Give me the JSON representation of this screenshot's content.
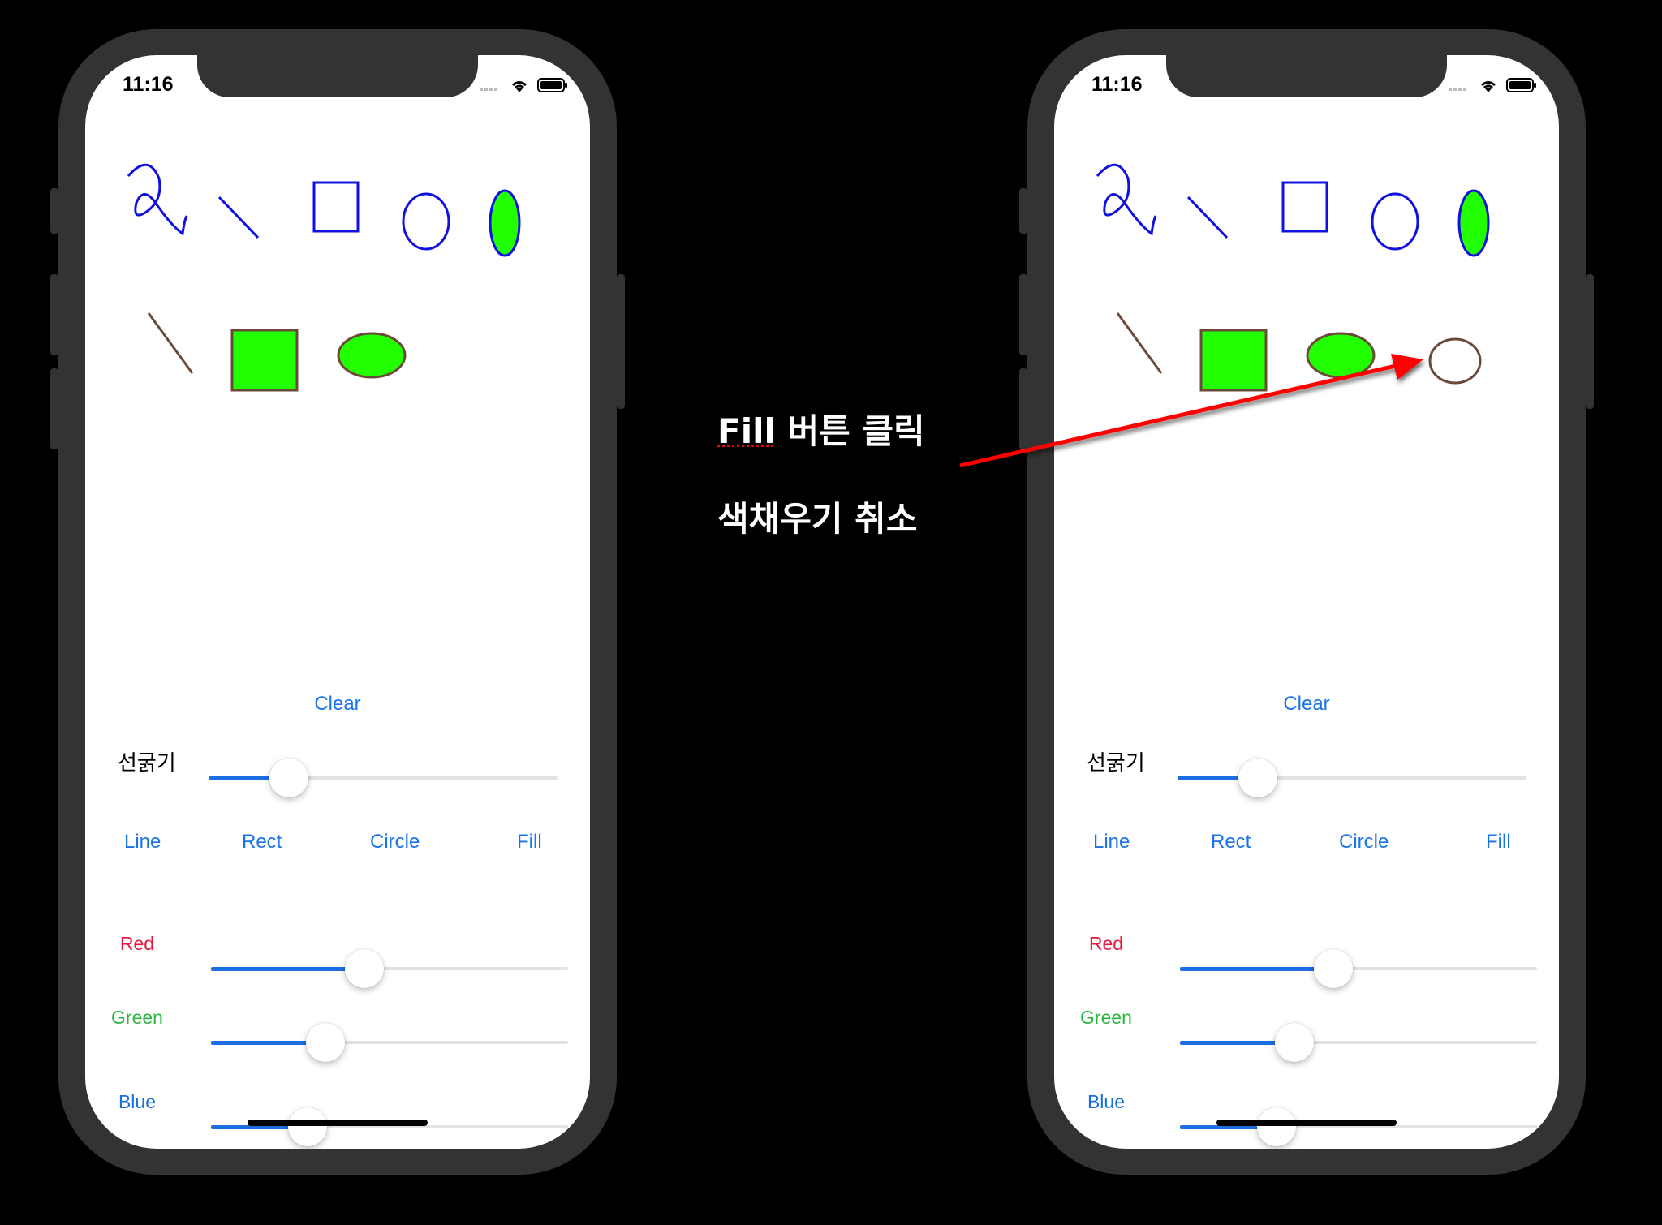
{
  "status_bar": {
    "time": "11:16"
  },
  "controls": {
    "clear_label": "Clear",
    "line_width_label": "선굵기",
    "tools": [
      "Line",
      "Rect",
      "Circle",
      "Fill"
    ],
    "color_labels": {
      "red": "Red",
      "green": "Green",
      "blue": "Blue"
    }
  },
  "colors": {
    "tool_blue": "#1a73e8",
    "red_label": "#e8173f",
    "green_label": "#2bb541",
    "blue_label": "#1a6ee0",
    "shape_fill": "#22ff00",
    "stroke_brown": "#6b4a3a",
    "stroke_blue": "#1010e0",
    "arrow": "#ff0000"
  },
  "phone_left": {
    "line_width": 0.23,
    "red": 0.43,
    "green": 0.32,
    "blue": 0.27
  },
  "phone_right": {
    "line_width": 0.23,
    "red": 0.43,
    "green": 0.32,
    "blue": 0.27
  },
  "annotation": {
    "line1_fill": "Fill",
    "line1_rest": " 버튼 클릭",
    "line2": "색채우기 취소"
  }
}
